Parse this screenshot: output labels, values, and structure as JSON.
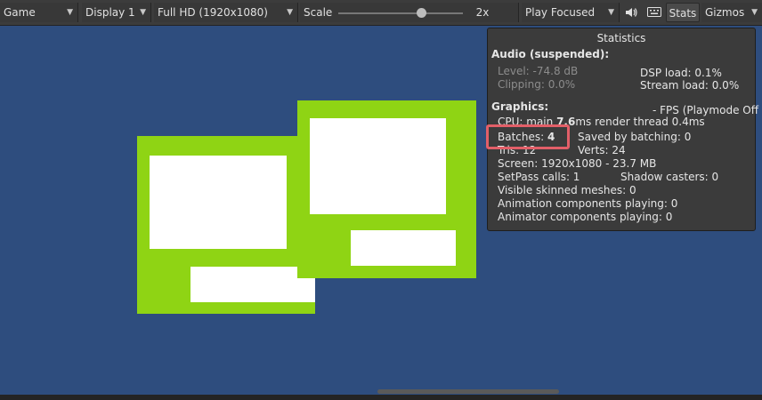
{
  "toolbar": {
    "view_mode": "Game",
    "display": "Display 1",
    "resolution": "Full HD (1920x1080)",
    "scale_label": "Scale",
    "scale_value": "2x",
    "scale_fraction": 0.63,
    "play_mode": "Play Focused",
    "mute_icon": "speaker-icon",
    "keyboard_icon": "keyboard-icon",
    "stats_label": "Stats",
    "gizmos_label": "Gizmos"
  },
  "stats_panel": {
    "title": "Statistics",
    "audio_header": "Audio (suspended):",
    "level": "Level: -74.8 dB",
    "clipping": "Clipping: 0.0%",
    "dsp_load": "DSP load: 0.1%",
    "stream_load": "Stream load: 0.0%",
    "graphics_header": "Graphics:",
    "fps": "- FPS (Playmode Off",
    "cpu_label": "CPU: main ",
    "cpu_main": "7.6",
    "cpu_rest": "ms  render thread 0.4ms",
    "batches_label": "Batches: ",
    "batches_value": "4",
    "saved_by_batching": "Saved by batching: 0",
    "tris": "Tris: 12",
    "verts": "Verts: 24",
    "screen": "Screen: 1920x1080 - 23.7 MB",
    "setpass": "SetPass calls: 1",
    "shadow_casters": "Shadow casters: 0",
    "skinned_meshes": "Visible skinned meshes: 0",
    "animation_components": "Animation components playing: 0",
    "animator_components": "Animator components playing: 0"
  },
  "colors": {
    "viewport_bg": "#2e4d7e",
    "sprite_green": "#8fd414",
    "highlight": "#e25f68"
  }
}
